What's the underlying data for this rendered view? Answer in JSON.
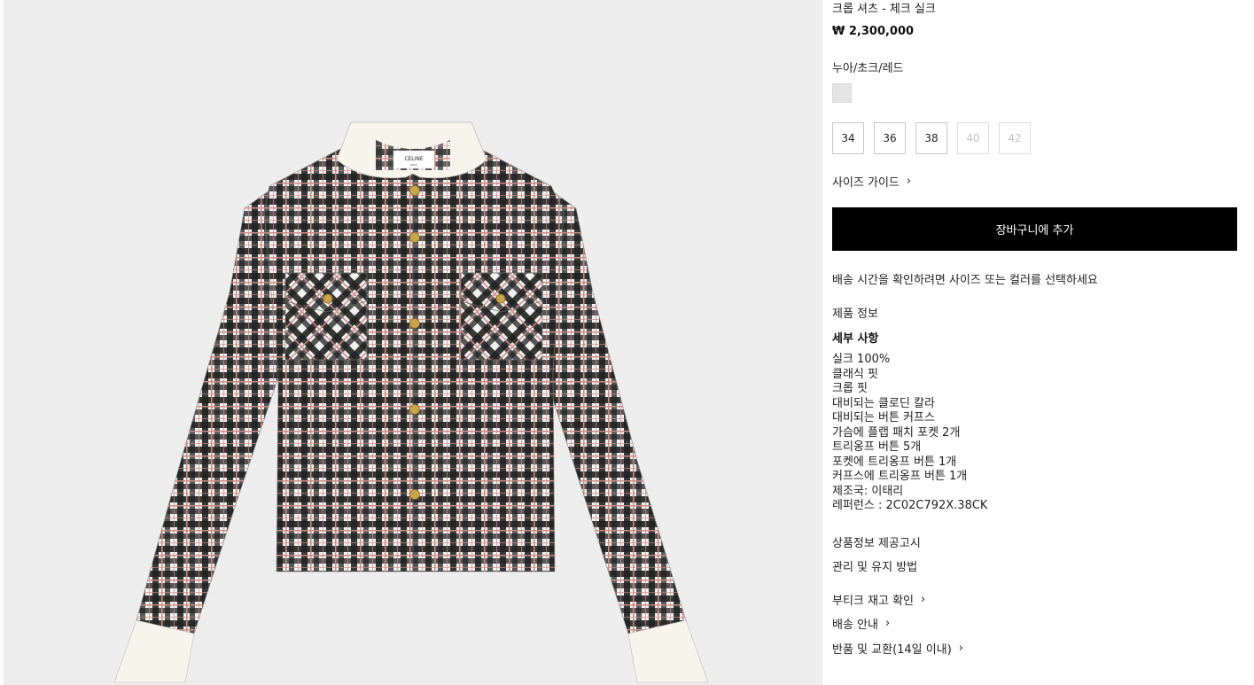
{
  "product": {
    "name": "크롭 셔츠 - 체크 실크",
    "price": "₩ 2,300,000",
    "color_name": "누아/초크/레드",
    "swatch_color": "#e4e4e4"
  },
  "sizes": [
    {
      "label": "34",
      "available": true
    },
    {
      "label": "36",
      "available": true
    },
    {
      "label": "38",
      "available": true
    },
    {
      "label": "40",
      "available": false
    },
    {
      "label": "42",
      "available": false
    }
  ],
  "size_guide_label": "사이즈 가이드",
  "add_to_cart_label": "장바구니에 추가",
  "delivery_note": "배송 시간을 확인하려면 사이즈 또는 컬러를 선택하세요",
  "product_info_label": "제품 정보",
  "details_title": "세부 사항",
  "details": [
    "실크 100%",
    "클래식 핏",
    "크롭 핏",
    "대비되는 클로딘 칼라",
    "대비되는 버튼 커프스",
    "가슴에 플랩 패치 포켓 2개",
    "트리옹프 버튼 5개",
    "포켓에 트리옹프 버튼 1개",
    "커프스에 트리옹프 버튼 1개",
    "제조국: 이태리",
    "레퍼런스 : 2C02C792X.38CK"
  ],
  "notice_label": "상품정보 제공고시",
  "care_label": "관리 및 유지 방법",
  "links": {
    "boutique_stock": "부티크 재고 확인",
    "shipping": "배송 안내",
    "returns": "반품 및 교환(14일 이내)"
  },
  "image": {
    "brand_label": "CELINE",
    "label_sub": "PARIS",
    "background": "#ededed",
    "shirt_colors": {
      "dark": "#222222",
      "light": "#f1f1ef",
      "red": "#c98b85",
      "collar": "#f7f4ec",
      "button": "#c9a44a"
    }
  }
}
